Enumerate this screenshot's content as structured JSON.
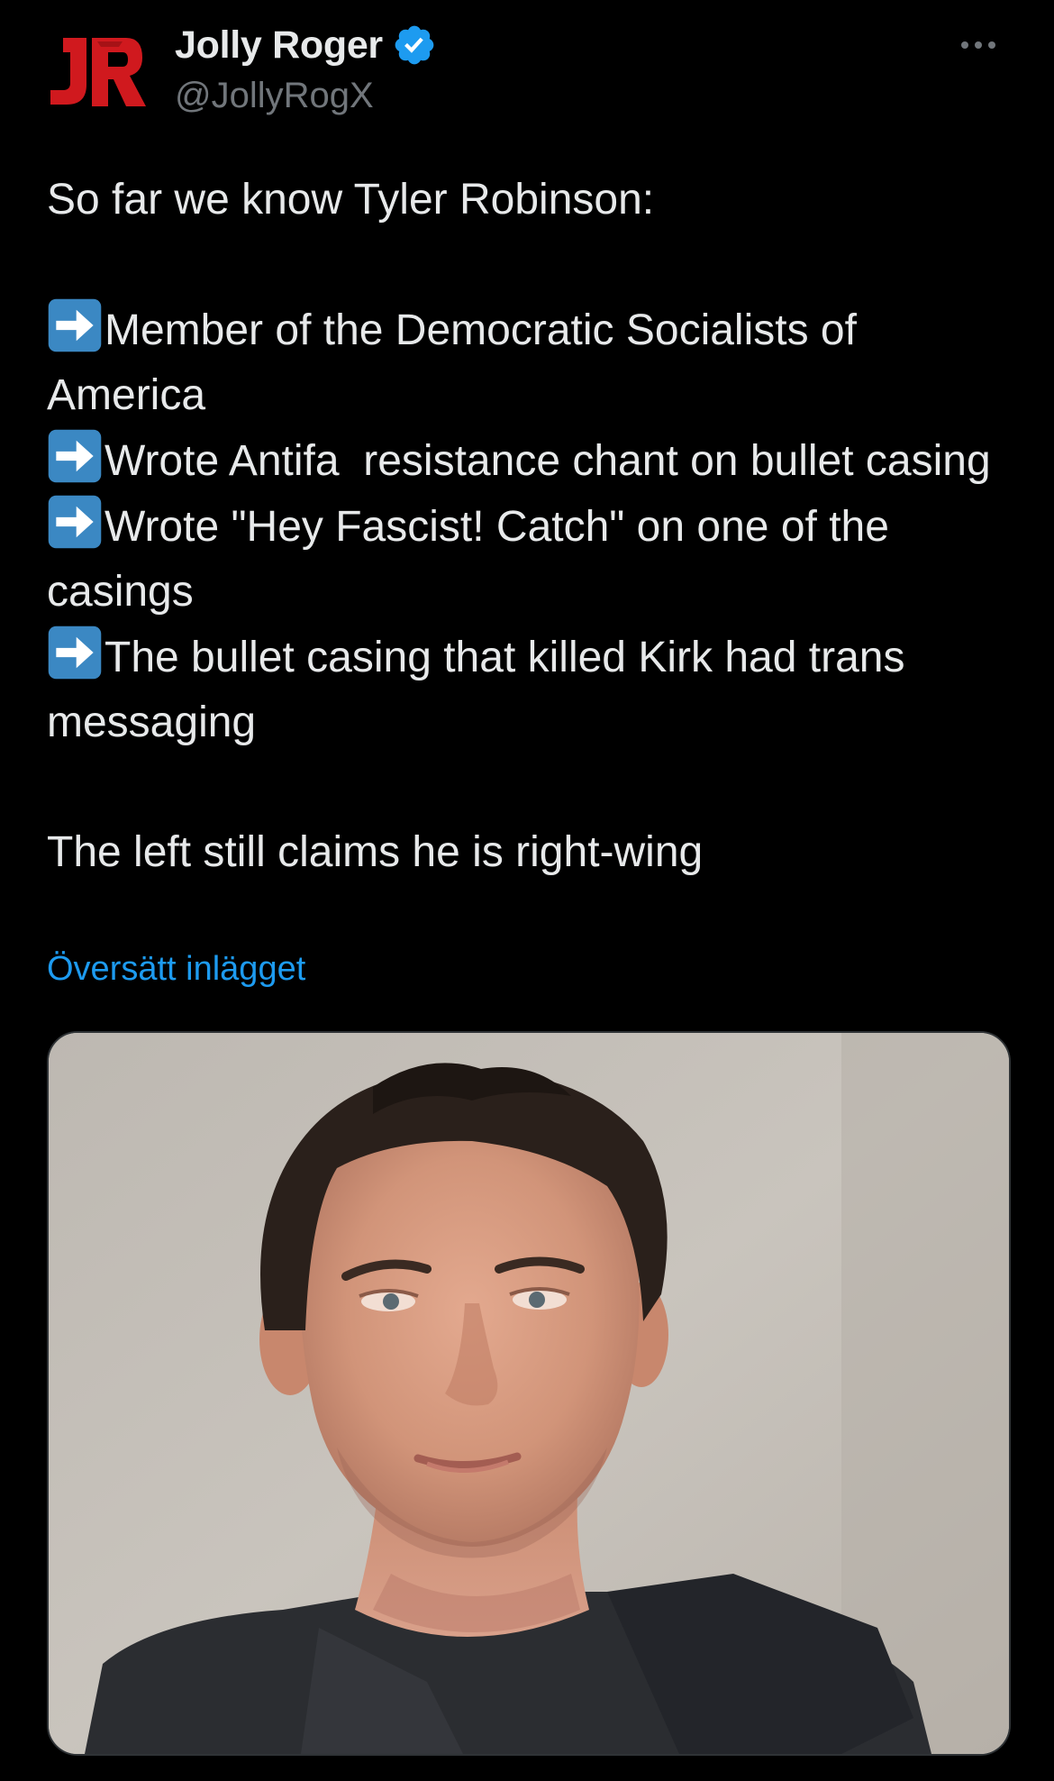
{
  "post": {
    "author": {
      "avatar_text": "JR",
      "display_name": "Jolly Roger",
      "handle": "@JollyRogX",
      "verified": true
    },
    "more_icon": "more-horizontal-icon",
    "text": {
      "intro": "So far we know Tyler Robinson:",
      "bullets": [
        "Member of the Democratic Socialists of America",
        "Wrote Antifa  resistance chant on bullet casing",
        "Wrote \"Hey Fascist! Catch\" on one of the casings",
        "The bullet casing that killed Kirk had trans messaging"
      ],
      "bullet_icon": "right-arrow-emoji-icon",
      "closing": "The left still claims he is right-wing"
    },
    "translate_label": "Översätt inlägget",
    "media": {
      "type": "photo",
      "icon": "portrait-photo"
    }
  },
  "colors": {
    "background": "#000000",
    "primary_text": "#e7e9ea",
    "secondary_text": "#71767b",
    "link": "#1d9bf0",
    "verified_badge": "#1d9bf0",
    "avatar_logo": "#d0191e",
    "arrow_emoji_bg": "#3b88c3"
  }
}
